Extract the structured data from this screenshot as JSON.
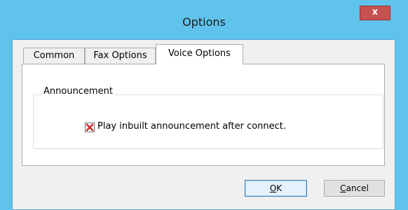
{
  "window": {
    "title": "Options",
    "close_label": "x",
    "accent_color": "#5fc3ec"
  },
  "tabs": [
    {
      "label": "Common",
      "active": false
    },
    {
      "label": "Fax Options",
      "active": false
    },
    {
      "label": "Voice Options",
      "active": true
    }
  ],
  "announcement_group": {
    "label": "Announcement",
    "checkbox": {
      "label": "Play inbuilt announcement after connect.",
      "state": "indeterminate-x",
      "mark_color": "#d12a2a",
      "icon": "x-mark-icon"
    }
  },
  "buttons": {
    "ok": {
      "accel": "O",
      "rest": "K"
    },
    "cancel": {
      "accel": "C",
      "rest": "ancel"
    }
  }
}
